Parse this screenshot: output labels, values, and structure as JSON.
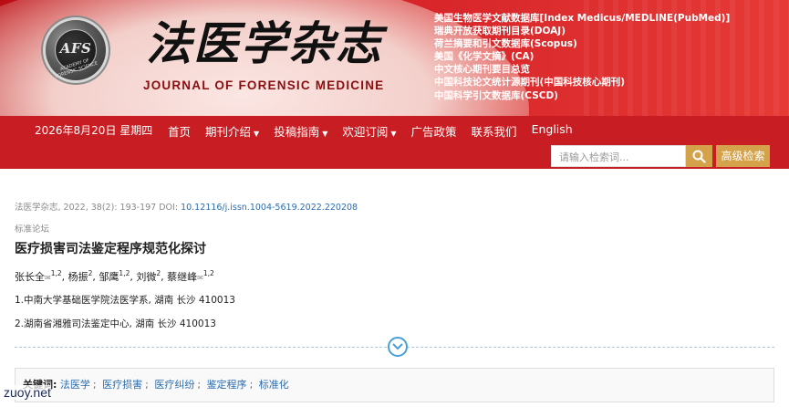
{
  "brand": {
    "logo_text": "AFS",
    "logo_ring_text": "ACADEMY OF FORENSIC SCIENCE",
    "journal_name_cn": "法医学杂志",
    "journal_name_en": "JOURNAL OF FORENSIC MEDICINE",
    "indexes": [
      "美国生物医学文献数据库[Index Medicus/MEDLINE(PubMed)]",
      "瑞典开放获取期刊目录(DOAJ)",
      "荷兰摘要和引文数据库(Scopus)",
      "美国《化学文摘》(CA)",
      "中文核心期刊要目总览",
      "中国科技论文统计源期刊(中国科技核心期刊)",
      "中国科学引文数据库(CSCD)"
    ]
  },
  "nav": {
    "date": "2026年8月20日 星期四",
    "items": [
      {
        "label": "首页",
        "dropdown": false
      },
      {
        "label": "期刊介绍",
        "dropdown": true
      },
      {
        "label": "投稿指南",
        "dropdown": true
      },
      {
        "label": "欢迎订阅",
        "dropdown": true
      },
      {
        "label": "广告政策",
        "dropdown": false
      },
      {
        "label": "联系我们",
        "dropdown": false
      },
      {
        "label": "English",
        "dropdown": false
      }
    ],
    "search_placeholder": "请输入检索词...",
    "advanced_search_label": "高级检索"
  },
  "article": {
    "citation": "法医学杂志, 2022, 38(2): 193-197 DOI: ",
    "doi": "10.12116/j.issn.1004-5619.2022.220208",
    "column": "标准论坛",
    "title": "医疗损害司法鉴定程序规范化探讨",
    "authors": [
      {
        "name": "张长全",
        "mail": true,
        "sup": "1,2"
      },
      {
        "name": "杨振",
        "mail": false,
        "sup": "2"
      },
      {
        "name": "邹鹰",
        "mail": false,
        "sup": "1,2"
      },
      {
        "name": "刘微",
        "mail": false,
        "sup": "2"
      },
      {
        "name": "蔡继峰",
        "mail": true,
        "sup": "1,2"
      }
    ],
    "affiliations": [
      "1.中南大学基础医学院法医学系, 湖南 长沙 410013",
      "2.湖南省湘雅司法鉴定中心, 湖南 长沙 410013"
    ],
    "keywords_label": "关键词:",
    "keywords": [
      "法医学",
      "医疗损害",
      "医疗纠纷",
      "鉴定程序",
      "标准化"
    ]
  },
  "watermark": "zuoy.net",
  "colors": {
    "nav_bg": "#c81d22",
    "accent_gold": "#d4a24a",
    "link_blue": "#2a6db0"
  }
}
